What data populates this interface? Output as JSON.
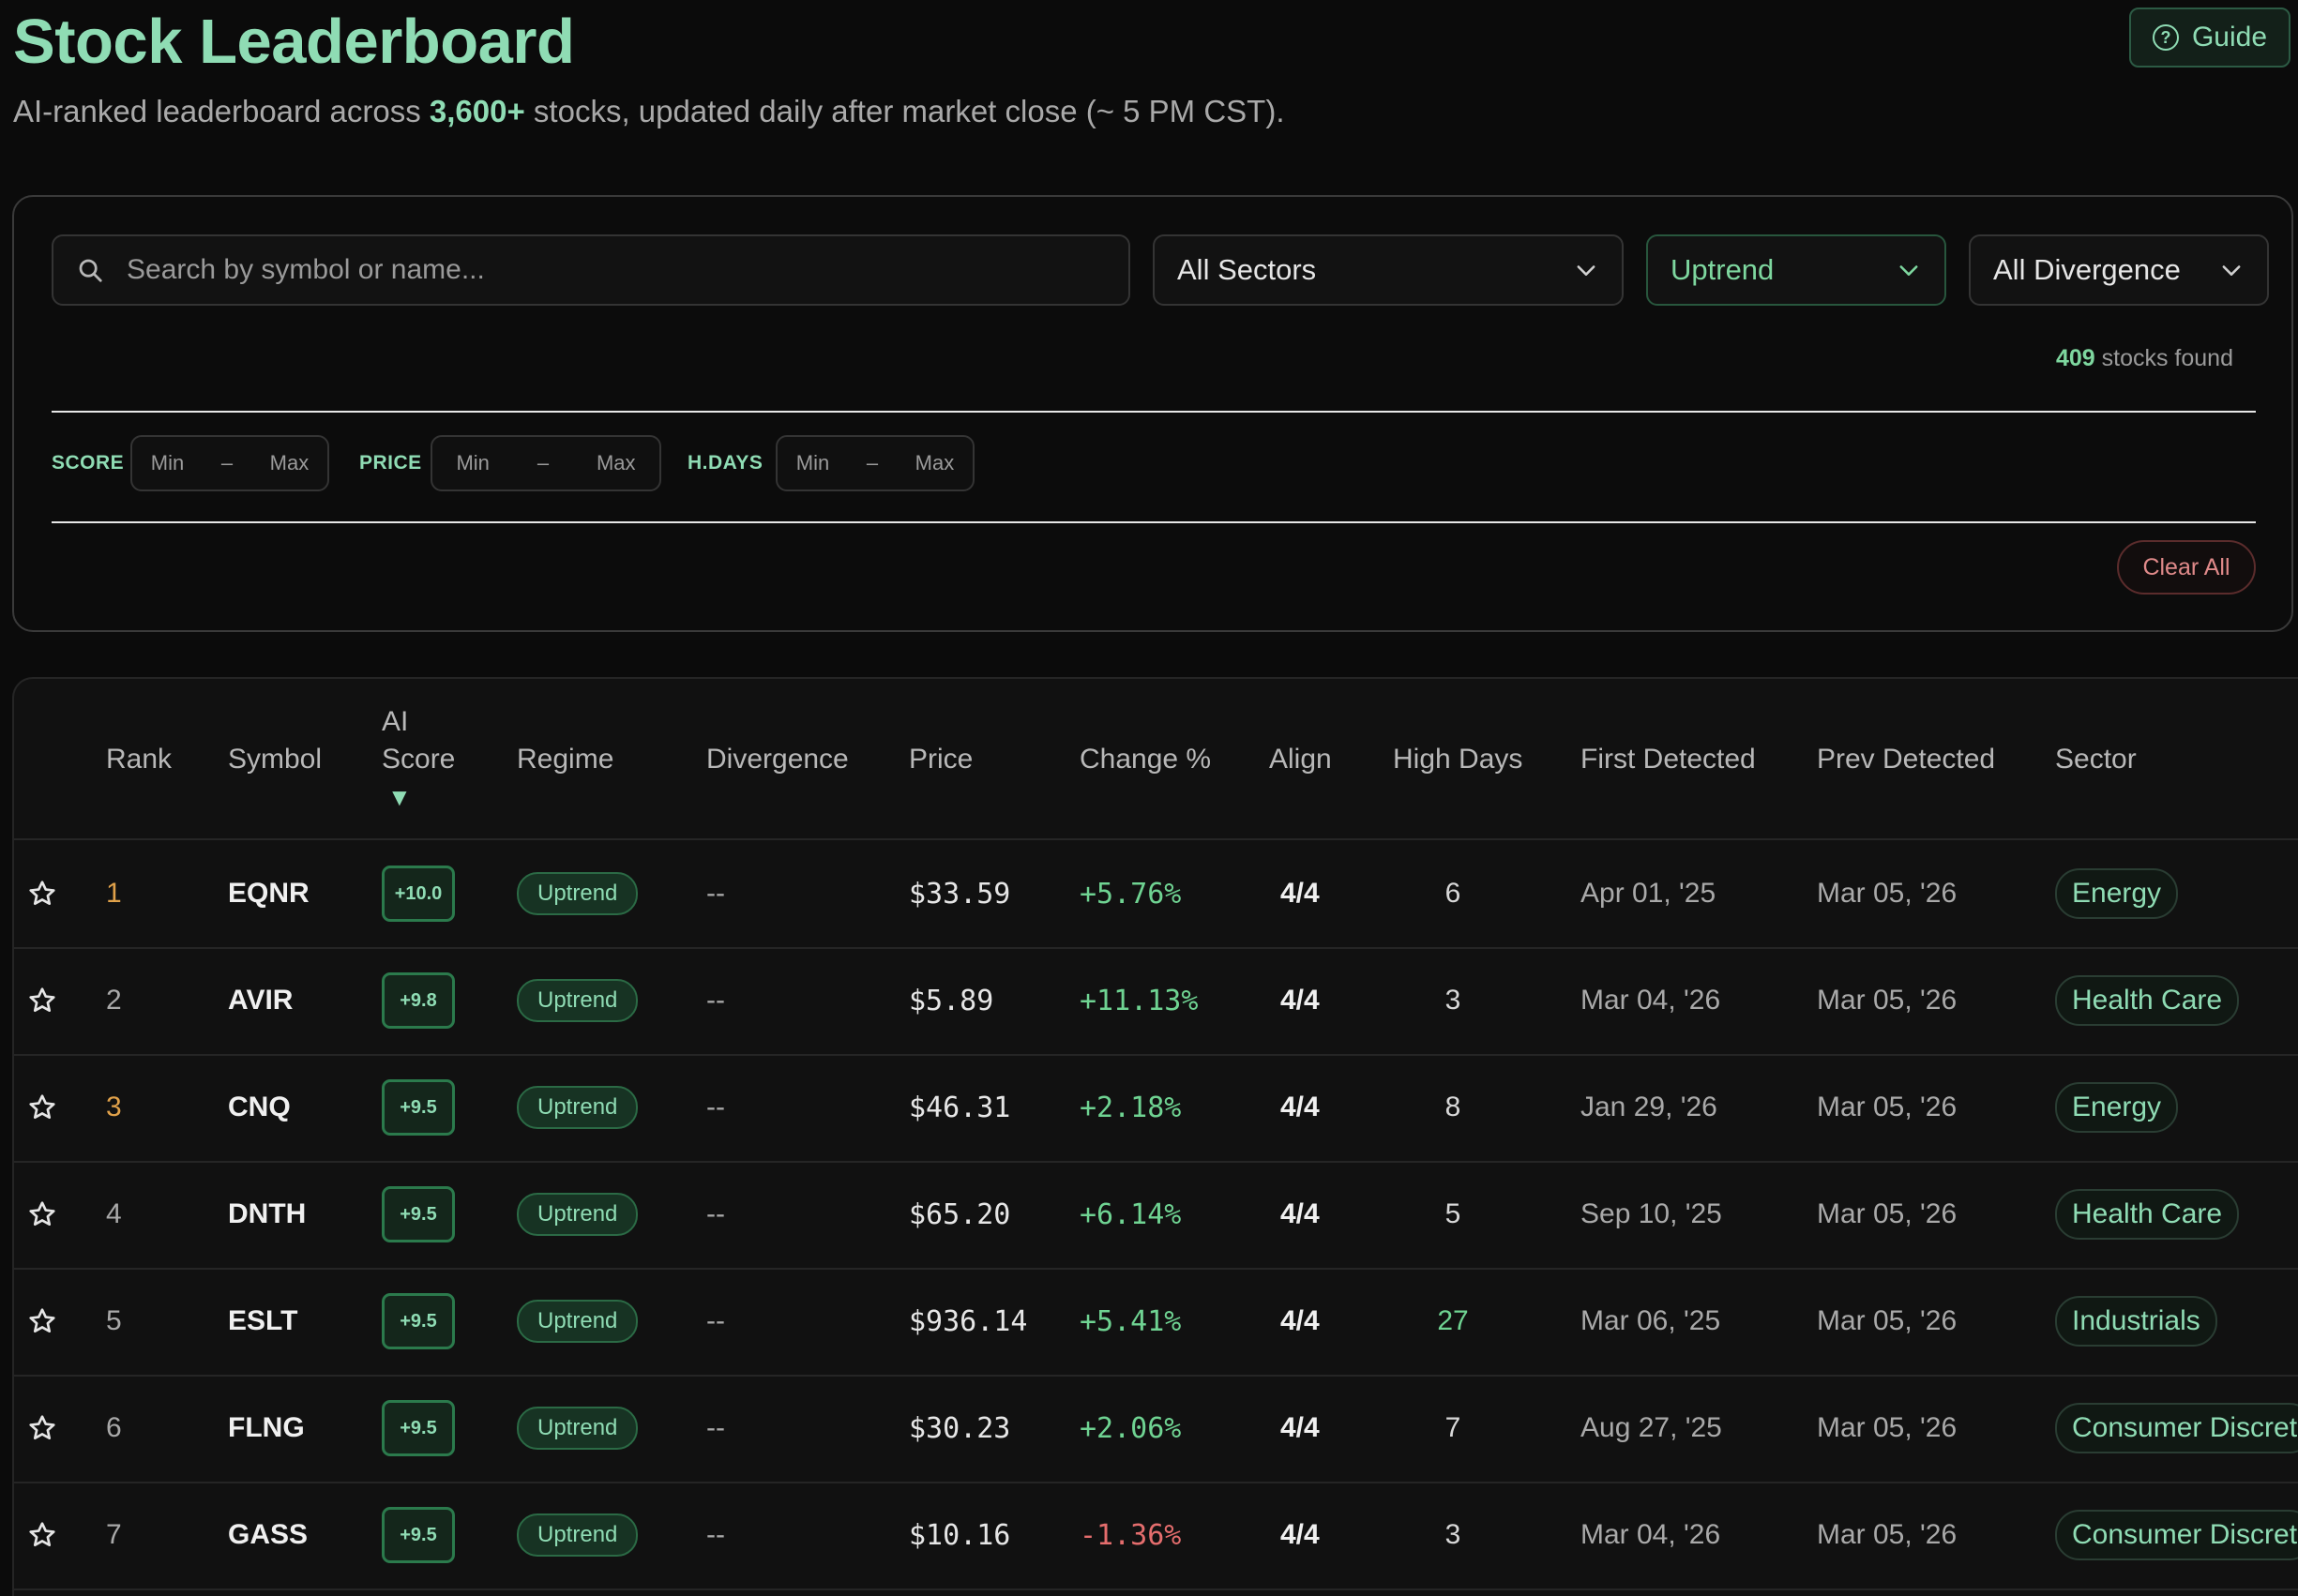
{
  "header": {
    "title": "Stock Leaderboard",
    "subtitle_pre": "AI-ranked leaderboard across ",
    "subtitle_highlight": "3,600+",
    "subtitle_post": " stocks, updated daily after market close (~ 5 PM CST).",
    "guide_label": "Guide",
    "guide_icon": "question-circle-icon"
  },
  "filters": {
    "search_placeholder": "Search by symbol or name...",
    "search_value": "",
    "sector_select": "All Sectors",
    "regime_select": "Uptrend",
    "divergence_select": "All Divergence",
    "found_count": "409",
    "found_suffix": " stocks found",
    "ranges": [
      {
        "label": "SCORE",
        "min": "Min",
        "sep": "–",
        "max": "Max"
      },
      {
        "label": "PRICE",
        "min": "Min",
        "sep": "–",
        "max": "Max"
      },
      {
        "label": "H.DAYS",
        "min": "Min",
        "sep": "–",
        "max": "Max"
      }
    ],
    "clear_label": "Clear All"
  },
  "table": {
    "headers": {
      "rank": "Rank",
      "symbol": "Symbol",
      "ai_score_1": "AI",
      "ai_score_2": "Score",
      "sort_indicator": "▼",
      "regime": "Regime",
      "divergence": "Divergence",
      "price": "Price",
      "change": "Change %",
      "align": "Align",
      "high_days": "High Days",
      "first_detected": "First Detected",
      "prev_detected": "Prev Detected",
      "sector": "Sector"
    },
    "rows": [
      {
        "rank": "1",
        "symbol": "EQNR",
        "score": "+10.0",
        "regime": "Uptrend",
        "divergence": "--",
        "price": "$33.59",
        "change": "+5.76%",
        "align": "4/4",
        "high_days": "6",
        "first": "Apr 01, '25",
        "prev": "Mar 05, '26",
        "sector": "Energy"
      },
      {
        "rank": "2",
        "symbol": "AVIR",
        "score": "+9.8",
        "regime": "Uptrend",
        "divergence": "--",
        "price": "$5.89",
        "change": "+11.13%",
        "align": "4/4",
        "high_days": "3",
        "first": "Mar 04, '26",
        "prev": "Mar 05, '26",
        "sector": "Health Care"
      },
      {
        "rank": "3",
        "symbol": "CNQ",
        "score": "+9.5",
        "regime": "Uptrend",
        "divergence": "--",
        "price": "$46.31",
        "change": "+2.18%",
        "align": "4/4",
        "high_days": "8",
        "first": "Jan 29, '26",
        "prev": "Mar 05, '26",
        "sector": "Energy"
      },
      {
        "rank": "4",
        "symbol": "DNTH",
        "score": "+9.5",
        "regime": "Uptrend",
        "divergence": "--",
        "price": "$65.20",
        "change": "+6.14%",
        "align": "4/4",
        "high_days": "5",
        "first": "Sep 10, '25",
        "prev": "Mar 05, '26",
        "sector": "Health Care"
      },
      {
        "rank": "5",
        "symbol": "ESLT",
        "score": "+9.5",
        "regime": "Uptrend",
        "divergence": "--",
        "price": "$936.14",
        "change": "+5.41%",
        "align": "4/4",
        "high_days": "27",
        "first": "Mar 06, '25",
        "prev": "Mar 05, '26",
        "sector": "Industrials"
      },
      {
        "rank": "6",
        "symbol": "FLNG",
        "score": "+9.5",
        "regime": "Uptrend",
        "divergence": "--",
        "price": "$30.23",
        "change": "+2.06%",
        "align": "4/4",
        "high_days": "7",
        "first": "Aug 27, '25",
        "prev": "Mar 05, '26",
        "sector": "Consumer Discret"
      },
      {
        "rank": "7",
        "symbol": "GASS",
        "score": "+9.5",
        "regime": "Uptrend",
        "divergence": "--",
        "price": "$10.16",
        "change": "-1.36%",
        "align": "4/4",
        "high_days": "3",
        "first": "Mar 04, '26",
        "prev": "Mar 05, '26",
        "sector": "Consumer Discret"
      }
    ]
  },
  "colors": {
    "accent": "#8fdcb4",
    "positive": "#6fd392",
    "negative": "#e46d6d",
    "rank_highlight": "#e0a14a",
    "background": "#0b0b0b"
  }
}
